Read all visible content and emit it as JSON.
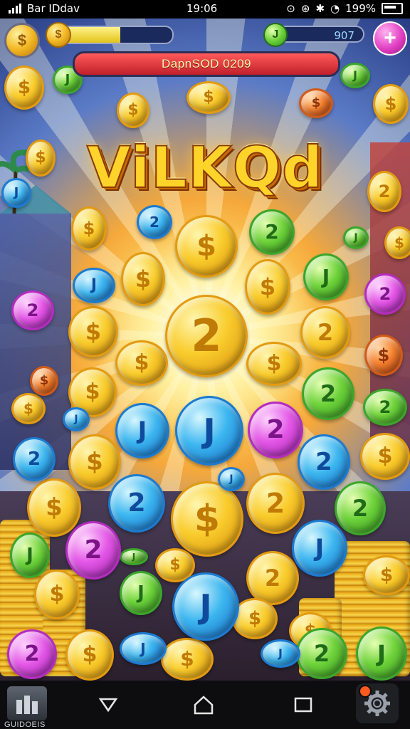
{
  "status_bar": {
    "carrier": "Bar IDdav",
    "time": "19:06",
    "battery": "199%"
  },
  "hud": {
    "xp_progress": 0.58,
    "gem_count": "907",
    "plus_label": "+",
    "banner_text": "DapnSOD 0209"
  },
  "title": {
    "text": "ViLKQd"
  },
  "coins": [
    {
      "color": "gold",
      "symbol": "$"
    },
    {
      "color": "green",
      "symbol": "2"
    },
    {
      "color": "blue",
      "symbol": "J"
    },
    {
      "color": "pink",
      "symbol": "2"
    },
    {
      "color": "orange",
      "symbol": "$"
    }
  ],
  "nav_bar": {
    "home_label": "GUIDOEIS",
    "back_icon": "back-triangle-icon",
    "home_icon": "home-icon",
    "recents_icon": "recents-square-icon",
    "settings_icon": "gear-icon"
  },
  "colors": {
    "gold": "#f9cc2c",
    "green": "#6ed23a",
    "blue": "#3cb6ef",
    "pink": "#e357e6",
    "banner_red": "#c11f2b"
  }
}
